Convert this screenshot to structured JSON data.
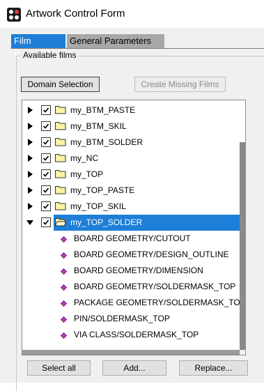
{
  "window": {
    "title": "Artwork Control Form"
  },
  "tabs": [
    {
      "label": "Film Control",
      "active": true
    },
    {
      "label": "General Parameters",
      "active": false
    }
  ],
  "group": {
    "label": "Available films"
  },
  "buttons": {
    "domain_selection": "Domain Selection",
    "create_missing_films": "Create Missing Films",
    "select_all": "Select all",
    "add": "Add...",
    "replace": "Replace..."
  },
  "films": [
    {
      "label": "my_BTM_PASTE",
      "checked": true,
      "expanded": false
    },
    {
      "label": "my_BTM_SKIL",
      "checked": true,
      "expanded": false
    },
    {
      "label": "my_BTM_SOLDER",
      "checked": true,
      "expanded": false
    },
    {
      "label": "my_NC",
      "checked": true,
      "expanded": false
    },
    {
      "label": "my_TOP",
      "checked": true,
      "expanded": false
    },
    {
      "label": "my_TOP_PASTE",
      "checked": true,
      "expanded": false
    },
    {
      "label": "my_TOP_SKIL",
      "checked": true,
      "expanded": false
    },
    {
      "label": "my_TOP_SOLDER",
      "checked": true,
      "expanded": true,
      "selected": true
    }
  ],
  "layers": [
    "BOARD GEOMETRY/CUTOUT",
    "BOARD GEOMETRY/DESIGN_OUTLINE",
    "BOARD GEOMETRY/DIMENSION",
    "BOARD GEOMETRY/SOLDERMASK_TOP",
    "PACKAGE GEOMETRY/SOLDERMASK_TOP",
    "PIN/SOLDERMASK_TOP",
    "VIA CLASS/SOLDERMASK_TOP"
  ],
  "colors": {
    "accent": "#1e7fd8",
    "folder": "#fff2a0",
    "layer_icon": "#c23ac2"
  }
}
